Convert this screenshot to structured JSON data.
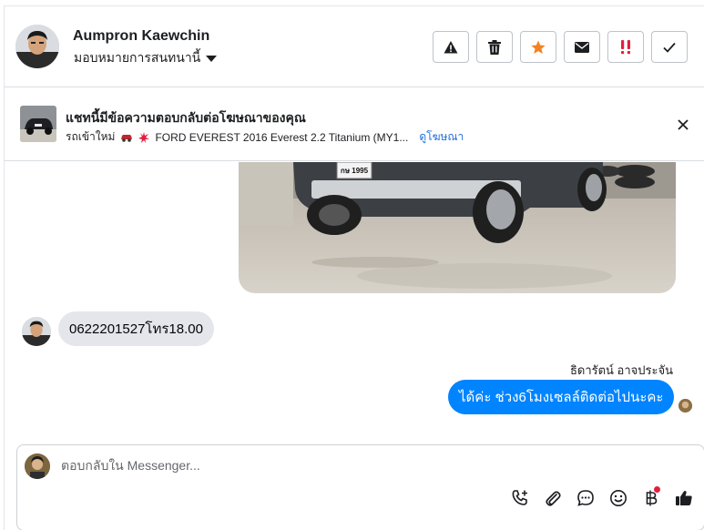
{
  "contact": {
    "name": "Aumpron Kaewchin",
    "assign_label": "มอบหมายการสนทนานี้"
  },
  "toolbar": {
    "buttons": [
      {
        "icon": "alert-icon",
        "color": "#1c1e21"
      },
      {
        "icon": "trash-icon",
        "color": "#1c1e21"
      },
      {
        "icon": "star-icon",
        "color": "#f5821f"
      },
      {
        "icon": "mail-icon",
        "color": "#1c1e21"
      },
      {
        "icon": "double-exclamation-icon",
        "color": "#e41e3f"
      },
      {
        "icon": "check-icon",
        "color": "#1c1e21"
      }
    ]
  },
  "ad_banner": {
    "title": "แชทนี้มีข้อความตอบกลับต่อโฆษณาของคุณ",
    "subtitle_prefix": "รถเข้าใหม่",
    "subtitle_text": "FORD EVEREST 2016 Everest 2.2 Titanium (MY1...",
    "link": "ดูโฆษณา"
  },
  "messages": {
    "license_plate": "กษ 1995",
    "incoming_text": "0622201527โทร18.00",
    "outgoing_sender": "ธิดารัตน์ อาจประจัน",
    "outgoing_text": "ได้ค่ะ ช่วง6โมงเซลล์ติดต่อไปนะคะ"
  },
  "composer": {
    "placeholder": "ตอบกลับใน Messenger..."
  },
  "colors": {
    "accent_blue": "#0084ff",
    "link_blue": "#216fdb",
    "bubble_gray": "#e4e6eb",
    "star_orange": "#f5821f",
    "alert_red": "#e41e3f"
  }
}
